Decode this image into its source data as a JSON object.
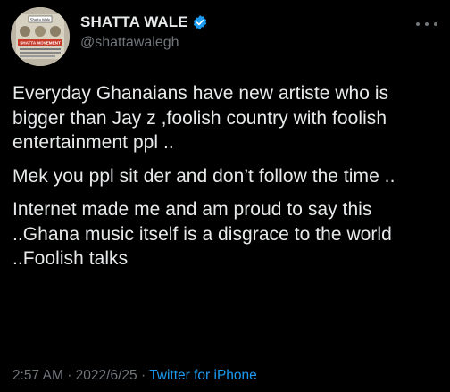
{
  "user": {
    "display_name": "SHATTA WALE",
    "handle": "@shattawalegh",
    "avatar_text_top": "Shatta Wale",
    "avatar_text_mid": "SHATTA MOVEMENT"
  },
  "tweet": {
    "paragraphs": [
      "Everyday Ghanaians have new artiste who is bigger than Jay z ,foolish country with foolish entertainment ppl ..",
      "Mek you ppl sit der and don’t follow the time ..",
      "Internet made me and am proud to say this ..Ghana music itself is a disgrace to the world ..Foolish talks"
    ],
    "time": "2:57 AM",
    "date": "2022/6/25",
    "separator": "·",
    "source": "Twitter for iPhone"
  },
  "colors": {
    "background": "#000000",
    "text": "#e7e9ea",
    "secondary": "#71767b",
    "accent": "#1d9bf0"
  },
  "icons": {
    "verified": "verified-badge-icon",
    "more": "more-options-icon"
  }
}
